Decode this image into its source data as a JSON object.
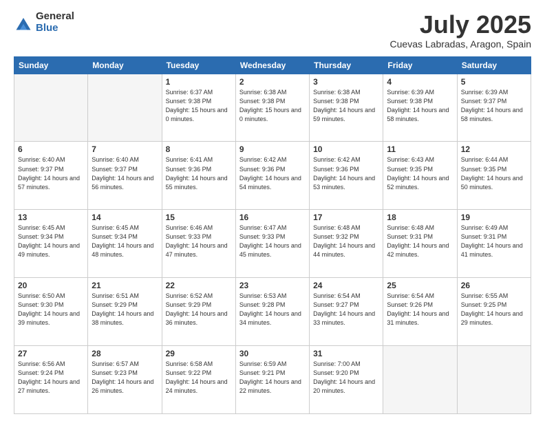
{
  "logo": {
    "general": "General",
    "blue": "Blue"
  },
  "title": "July 2025",
  "location": "Cuevas Labradas, Aragon, Spain",
  "header_days": [
    "Sunday",
    "Monday",
    "Tuesday",
    "Wednesday",
    "Thursday",
    "Friday",
    "Saturday"
  ],
  "weeks": [
    [
      {
        "day": "",
        "empty": true
      },
      {
        "day": "",
        "empty": true
      },
      {
        "day": "1",
        "sunrise": "6:37 AM",
        "sunset": "9:38 PM",
        "daylight": "15 hours and 0 minutes."
      },
      {
        "day": "2",
        "sunrise": "6:38 AM",
        "sunset": "9:38 PM",
        "daylight": "15 hours and 0 minutes."
      },
      {
        "day": "3",
        "sunrise": "6:38 AM",
        "sunset": "9:38 PM",
        "daylight": "14 hours and 59 minutes."
      },
      {
        "day": "4",
        "sunrise": "6:39 AM",
        "sunset": "9:38 PM",
        "daylight": "14 hours and 58 minutes."
      },
      {
        "day": "5",
        "sunrise": "6:39 AM",
        "sunset": "9:37 PM",
        "daylight": "14 hours and 58 minutes."
      }
    ],
    [
      {
        "day": "6",
        "sunrise": "6:40 AM",
        "sunset": "9:37 PM",
        "daylight": "14 hours and 57 minutes."
      },
      {
        "day": "7",
        "sunrise": "6:40 AM",
        "sunset": "9:37 PM",
        "daylight": "14 hours and 56 minutes."
      },
      {
        "day": "8",
        "sunrise": "6:41 AM",
        "sunset": "9:36 PM",
        "daylight": "14 hours and 55 minutes."
      },
      {
        "day": "9",
        "sunrise": "6:42 AM",
        "sunset": "9:36 PM",
        "daylight": "14 hours and 54 minutes."
      },
      {
        "day": "10",
        "sunrise": "6:42 AM",
        "sunset": "9:36 PM",
        "daylight": "14 hours and 53 minutes."
      },
      {
        "day": "11",
        "sunrise": "6:43 AM",
        "sunset": "9:35 PM",
        "daylight": "14 hours and 52 minutes."
      },
      {
        "day": "12",
        "sunrise": "6:44 AM",
        "sunset": "9:35 PM",
        "daylight": "14 hours and 50 minutes."
      }
    ],
    [
      {
        "day": "13",
        "sunrise": "6:45 AM",
        "sunset": "9:34 PM",
        "daylight": "14 hours and 49 minutes."
      },
      {
        "day": "14",
        "sunrise": "6:45 AM",
        "sunset": "9:34 PM",
        "daylight": "14 hours and 48 minutes."
      },
      {
        "day": "15",
        "sunrise": "6:46 AM",
        "sunset": "9:33 PM",
        "daylight": "14 hours and 47 minutes."
      },
      {
        "day": "16",
        "sunrise": "6:47 AM",
        "sunset": "9:33 PM",
        "daylight": "14 hours and 45 minutes."
      },
      {
        "day": "17",
        "sunrise": "6:48 AM",
        "sunset": "9:32 PM",
        "daylight": "14 hours and 44 minutes."
      },
      {
        "day": "18",
        "sunrise": "6:48 AM",
        "sunset": "9:31 PM",
        "daylight": "14 hours and 42 minutes."
      },
      {
        "day": "19",
        "sunrise": "6:49 AM",
        "sunset": "9:31 PM",
        "daylight": "14 hours and 41 minutes."
      }
    ],
    [
      {
        "day": "20",
        "sunrise": "6:50 AM",
        "sunset": "9:30 PM",
        "daylight": "14 hours and 39 minutes."
      },
      {
        "day": "21",
        "sunrise": "6:51 AM",
        "sunset": "9:29 PM",
        "daylight": "14 hours and 38 minutes."
      },
      {
        "day": "22",
        "sunrise": "6:52 AM",
        "sunset": "9:29 PM",
        "daylight": "14 hours and 36 minutes."
      },
      {
        "day": "23",
        "sunrise": "6:53 AM",
        "sunset": "9:28 PM",
        "daylight": "14 hours and 34 minutes."
      },
      {
        "day": "24",
        "sunrise": "6:54 AM",
        "sunset": "9:27 PM",
        "daylight": "14 hours and 33 minutes."
      },
      {
        "day": "25",
        "sunrise": "6:54 AM",
        "sunset": "9:26 PM",
        "daylight": "14 hours and 31 minutes."
      },
      {
        "day": "26",
        "sunrise": "6:55 AM",
        "sunset": "9:25 PM",
        "daylight": "14 hours and 29 minutes."
      }
    ],
    [
      {
        "day": "27",
        "sunrise": "6:56 AM",
        "sunset": "9:24 PM",
        "daylight": "14 hours and 27 minutes."
      },
      {
        "day": "28",
        "sunrise": "6:57 AM",
        "sunset": "9:23 PM",
        "daylight": "14 hours and 26 minutes."
      },
      {
        "day": "29",
        "sunrise": "6:58 AM",
        "sunset": "9:22 PM",
        "daylight": "14 hours and 24 minutes."
      },
      {
        "day": "30",
        "sunrise": "6:59 AM",
        "sunset": "9:21 PM",
        "daylight": "14 hours and 22 minutes."
      },
      {
        "day": "31",
        "sunrise": "7:00 AM",
        "sunset": "9:20 PM",
        "daylight": "14 hours and 20 minutes."
      },
      {
        "day": "",
        "empty": true
      },
      {
        "day": "",
        "empty": true
      }
    ]
  ],
  "labels": {
    "sunrise": "Sunrise:",
    "sunset": "Sunset:",
    "daylight": "Daylight:"
  }
}
